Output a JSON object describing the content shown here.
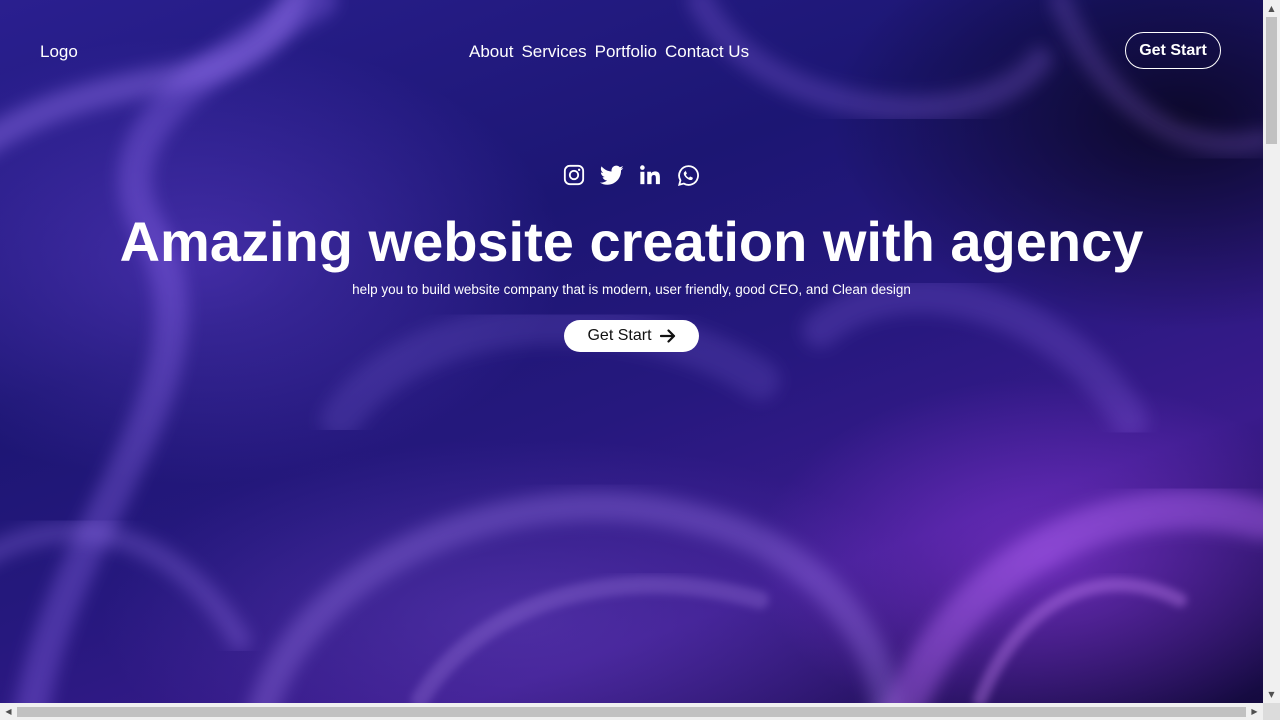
{
  "header": {
    "logo_text": "Logo",
    "nav_items": [
      {
        "label": "About"
      },
      {
        "label": "Services"
      },
      {
        "label": "Portfolio"
      },
      {
        "label": "Contact Us"
      }
    ],
    "cta_label": "Get Start"
  },
  "hero": {
    "social_icons": [
      "instagram-icon",
      "twitter-icon",
      "linkedin-icon",
      "whatsapp-icon"
    ],
    "headline": "Amazing website creation with agency",
    "subline": "help you to build website company that is modern, user friendly, good CEO, and Clean design",
    "cta_label": "Get Start",
    "cta_icon": "arrow-right-icon"
  },
  "colors": {
    "background": "#1c1673",
    "text": "#ffffff",
    "button_bg": "#ffffff",
    "button_text": "#111111",
    "accent_glow": "#963ce6"
  },
  "scrollbars": {
    "vertical_icon_up": "▲",
    "vertical_icon_down": "▼",
    "horizontal_icon_left": "◀",
    "horizontal_icon_right": "▶"
  }
}
